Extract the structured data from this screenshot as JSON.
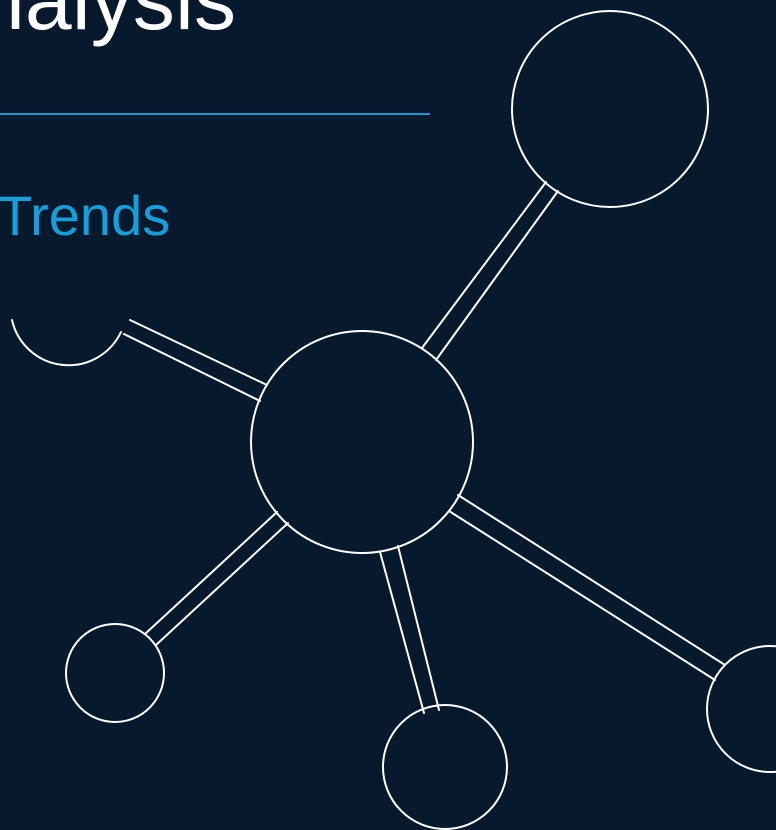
{
  "slide": {
    "title": "nalysis",
    "subtitle": "Trends"
  },
  "colors": {
    "background": "#07192c",
    "accent": "#139bd4",
    "text": "#ffffff",
    "graphic_stroke": "#ffffff"
  },
  "graphic": {
    "icon": "network-nodes-icon"
  }
}
